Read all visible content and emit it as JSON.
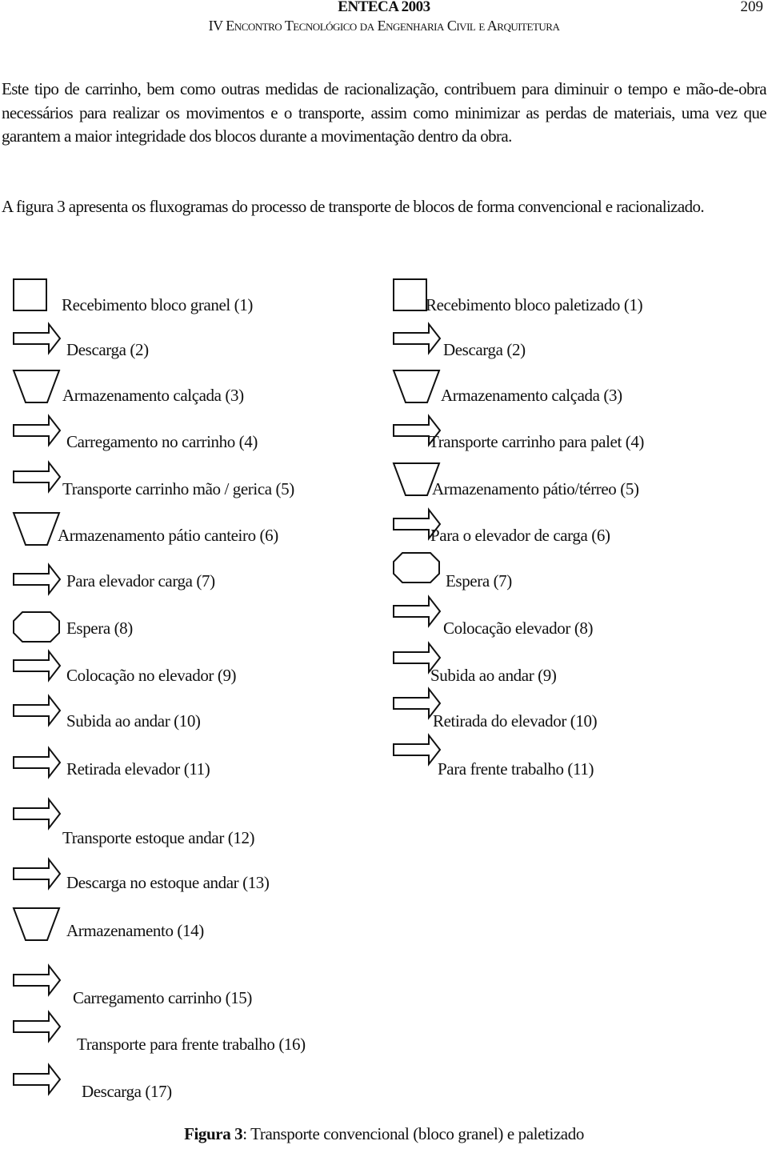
{
  "header": {
    "title": "ENTECA 2003",
    "subtitle": "IV Encontro Tecnológico da Engenharia Civil e Arquitetura",
    "page_number": "209"
  },
  "paragraphs": [
    "Este tipo de carrinho, bem como outras medidas de racionalização, contribuem para diminuir o tempo e mão-de-obra necessários para realizar os movimentos e o transporte, assim como minimizar as perdas de materiais, uma vez que garantem a maior integridade dos blocos durante a movimentação dentro da obra.",
    "A figura 3 apresenta os fluxogramas do processo de transporte de blocos de forma convencional e racionalizado."
  ],
  "figure": {
    "left_flow": [
      {
        "symbol": "square",
        "label": "Recebimento bloco granel (1)"
      },
      {
        "symbol": "arrow",
        "label": "Descarga (2)"
      },
      {
        "symbol": "trapezoid",
        "label": "Armazenamento calçada (3)"
      },
      {
        "symbol": "arrow",
        "label": "Carregamento no carrinho (4)"
      },
      {
        "symbol": "arrow",
        "label": "Transporte carrinho mão / gerica  (5)"
      },
      {
        "symbol": "trapezoid",
        "label": "Armazenamento pátio canteiro (6)"
      },
      {
        "symbol": "arrow",
        "label": "Para elevador carga (7)"
      },
      {
        "symbol": "octagon",
        "label": "Espera (8)"
      },
      {
        "symbol": "arrow",
        "label": "Colocação no elevador (9)"
      },
      {
        "symbol": "arrow",
        "label": "Subida ao andar  (10)"
      },
      {
        "symbol": "arrow",
        "label": "Retirada elevador  (11)"
      },
      {
        "symbol": "arrow",
        "label": "Transporte estoque andar (12)"
      },
      {
        "symbol": "arrow",
        "label": "Descarga no estoque andar (13)"
      },
      {
        "symbol": "trapezoid",
        "label": "Armazenamento (14)"
      },
      {
        "symbol": "arrow",
        "label": "Carregamento carrinho (15)"
      },
      {
        "symbol": "arrow",
        "label": "Transporte para frente trabalho (16)"
      },
      {
        "symbol": "arrow",
        "label": "Descarga (17)"
      }
    ],
    "right_flow": [
      {
        "symbol": "square",
        "label": "Recebimento bloco paletizado (1)"
      },
      {
        "symbol": "arrow",
        "label": "Descarga (2)"
      },
      {
        "symbol": "trapezoid",
        "label": "Armazenamento calçada (3)"
      },
      {
        "symbol": "arrow",
        "label": "Transporte carrinho para palet (4)"
      },
      {
        "symbol": "trapezoid",
        "label": "Armazenamento pátio/térreo (5)"
      },
      {
        "symbol": "arrow",
        "label": "Para o elevador de carga (6)"
      },
      {
        "symbol": "octagon",
        "label": "Espera (7)"
      },
      {
        "symbol": "arrow",
        "label": "Colocação elevador (8)"
      },
      {
        "symbol": "arrow",
        "label": "Subida ao andar (9)"
      },
      {
        "symbol": "arrow",
        "label": "Retirada do elevador (10)"
      },
      {
        "symbol": "arrow",
        "label": "Para frente trabalho (11)"
      }
    ],
    "caption_label": "Figura 3",
    "caption_text": ": Transporte convencional (bloco granel) e paletizado"
  }
}
